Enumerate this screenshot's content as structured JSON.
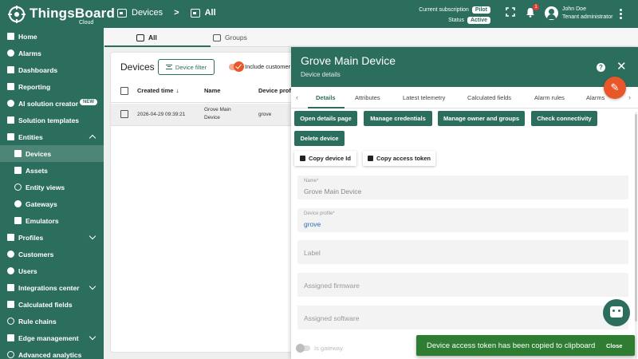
{
  "brand": {
    "name": "ThingsBoard",
    "sub": "Cloud"
  },
  "breadcrumb": {
    "parent": "Devices",
    "separator": ">",
    "current": "All"
  },
  "subscription": {
    "label": "Current subscription",
    "plan": "Pilot",
    "status_label": "Status",
    "status": "Active"
  },
  "notifications": {
    "count": "1"
  },
  "user": {
    "name": "John Doe",
    "role": "Tenant administrator"
  },
  "sidebar": {
    "items": [
      {
        "label": "Home",
        "icon": "home-icon"
      },
      {
        "label": "Alarms",
        "icon": "alarm-icon"
      },
      {
        "label": "Dashboards",
        "icon": "dashboard-icon"
      },
      {
        "label": "Reporting",
        "icon": "reporting-icon"
      },
      {
        "label": "AI solution creator",
        "icon": "ai-icon",
        "badge": "NEW"
      },
      {
        "label": "Solution templates",
        "icon": "templates-icon"
      },
      {
        "label": "Entities",
        "icon": "entities-icon"
      },
      {
        "label": "Devices",
        "icon": "devices-icon"
      },
      {
        "label": "Assets",
        "icon": "assets-icon"
      },
      {
        "label": "Entity views",
        "icon": "entity-views-icon"
      },
      {
        "label": "Gateways",
        "icon": "gateways-icon"
      },
      {
        "label": "Emulators",
        "icon": "emulators-icon"
      },
      {
        "label": "Profiles",
        "icon": "profiles-icon"
      },
      {
        "label": "Customers",
        "icon": "customers-icon"
      },
      {
        "label": "Users",
        "icon": "users-icon"
      },
      {
        "label": "Integrations center",
        "icon": "integrations-icon"
      },
      {
        "label": "Calculated fields",
        "icon": "calculated-fields-icon"
      },
      {
        "label": "Rule chains",
        "icon": "rule-chains-icon"
      },
      {
        "label": "Edge management",
        "icon": "edge-icon"
      },
      {
        "label": "Advanced analytics",
        "icon": "analytics-icon"
      }
    ]
  },
  "main_tabs": [
    {
      "label": "All"
    },
    {
      "label": "Groups"
    }
  ],
  "devices_card": {
    "title": "Devices",
    "filter_label": "Device filter",
    "include_label": "Include customer",
    "columns": {
      "created": "Created time",
      "name": "Name",
      "profile": "Device profil"
    },
    "row": {
      "created": "2026-04-29 09:39:21",
      "name_line1": "Grove Main",
      "name_line2": "Device",
      "profile": "grove"
    }
  },
  "panel": {
    "title": "Grove Main Device",
    "subtitle": "Device details",
    "tabs": [
      "Details",
      "Attributes",
      "Latest telemetry",
      "Calculated fields",
      "Alarm rules",
      "Alarms"
    ],
    "buttons": {
      "open_details": "Open details page",
      "manage_credentials": "Manage credentials",
      "manage_owner": "Manage owner and groups",
      "check_connectivity": "Check connectivity",
      "delete_device": "Delete device",
      "copy_id": "Copy device Id",
      "copy_token": "Copy access token"
    },
    "fields": {
      "name_label": "Name*",
      "name_value": "Grove Main Device",
      "profile_label": "Device profile*",
      "profile_value": "grove",
      "label_placeholder": "Label",
      "firmware_placeholder": "Assigned firmware",
      "software_placeholder": "Assigned software",
      "gateway_label": "Is gateway"
    }
  },
  "toast": {
    "message": "Device access token has been copied to clipboard",
    "close_label": "Close"
  },
  "colors": {
    "primary": "#2c6e5e",
    "accent": "#e8572a",
    "toast": "#2e7d32"
  }
}
